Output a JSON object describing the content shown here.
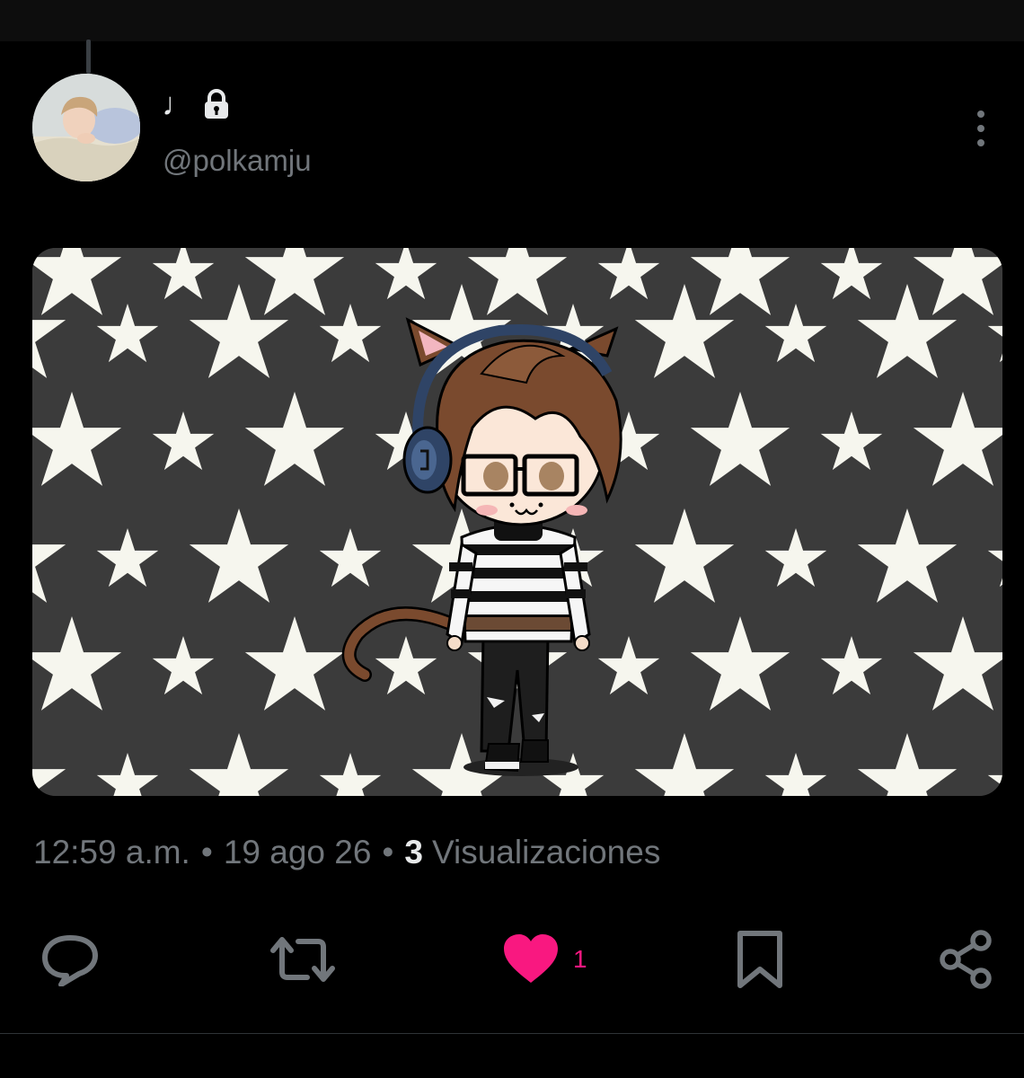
{
  "post": {
    "author": {
      "display_name": "♩",
      "handle": "@polkamju",
      "avatar_icon": "profile-photo-avatar",
      "locked_icon": "lock-icon"
    },
    "media": {
      "icon": "gacha-cat-character-on-star-background"
    },
    "meta": {
      "time": "12:59 a.m.",
      "separator": "•",
      "date": "19 ago 26",
      "views_count": "3",
      "views_label": "Visualizaciones"
    },
    "actions": {
      "reply_icon": "reply-icon",
      "repost_icon": "repost-icon",
      "like_icon": "heart-icon",
      "like_count": "1",
      "bookmark_icon": "bookmark-icon",
      "share_icon": "share-icon"
    }
  },
  "colors": {
    "background": "#000000",
    "text_primary": "#e7e9ea",
    "text_secondary": "#71767b",
    "like_active": "#f91880",
    "media_bg": "#3b3b3b",
    "star": "#f6f6ee"
  }
}
